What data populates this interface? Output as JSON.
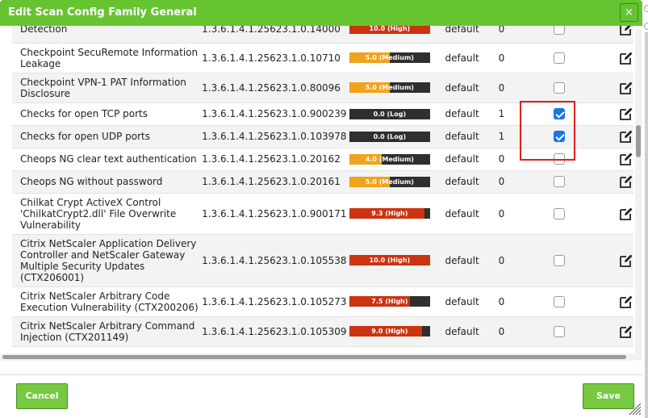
{
  "dialog": {
    "title": "Edit Scan Config Family General",
    "close_label": "×",
    "cancel_label": "Cancel",
    "save_label": "Save"
  },
  "colors": {
    "titlebar": "#66c430",
    "medium": "#f0a31c",
    "high": "#cc3311",
    "log": "#2f2f2f",
    "checkbox_checked": "#1a73e8",
    "highlight_box": "#e02020"
  },
  "rows": [
    {
      "name": "Detection",
      "oid": "1.3.6.1.4.1.25623.1.0.14000",
      "severity": {
        "label": "10.0 (High)",
        "level": "high",
        "fill_fraction": 1.0
      },
      "timeout": "default",
      "prefs": "0",
      "selected": false
    },
    {
      "name": "Checkpoint SecuRemote Information Leakage",
      "oid": "1.3.6.1.4.1.25623.1.0.10710",
      "severity": {
        "label": "5.0 (Medium)",
        "level": "medium",
        "fill_fraction": 0.5
      },
      "timeout": "default",
      "prefs": "0",
      "selected": false
    },
    {
      "name": "Checkpoint VPN-1 PAT Information Disclosure",
      "oid": "1.3.6.1.4.1.25623.1.0.80096",
      "severity": {
        "label": "5.0 (Medium)",
        "level": "medium",
        "fill_fraction": 0.5
      },
      "timeout": "default",
      "prefs": "0",
      "selected": false
    },
    {
      "name": "Checks for open TCP ports",
      "oid": "1.3.6.1.4.1.25623.1.0.900239",
      "severity": {
        "label": "0.0 (Log)",
        "level": "log",
        "fill_fraction": 0.0
      },
      "timeout": "default",
      "prefs": "1",
      "selected": true
    },
    {
      "name": "Checks for open UDP ports",
      "oid": "1.3.6.1.4.1.25623.1.0.103978",
      "severity": {
        "label": "0.0 (Log)",
        "level": "log",
        "fill_fraction": 0.0
      },
      "timeout": "default",
      "prefs": "1",
      "selected": true
    },
    {
      "name": "Cheops NG clear text authentication",
      "oid": "1.3.6.1.4.1.25623.1.0.20162",
      "severity": {
        "label": "4.0 (Medium)",
        "level": "medium",
        "fill_fraction": 0.4
      },
      "timeout": "default",
      "prefs": "0",
      "selected": false
    },
    {
      "name": "Cheops NG without password",
      "oid": "1.3.6.1.4.1.25623.1.0.20161",
      "severity": {
        "label": "5.0 (Medium)",
        "level": "medium",
        "fill_fraction": 0.5
      },
      "timeout": "default",
      "prefs": "0",
      "selected": false
    },
    {
      "name": "Chilkat Crypt ActiveX Control 'ChilkatCrypt2.dll' File Overwrite Vulnerability",
      "oid": "1.3.6.1.4.1.25623.1.0.900171",
      "severity": {
        "label": "9.3 (High)",
        "level": "high",
        "fill_fraction": 0.93
      },
      "timeout": "default",
      "prefs": "0",
      "selected": false
    },
    {
      "name": "Citrix NetScaler Application Delivery Controller and NetScaler Gateway Multiple Security Updates (CTX206001)",
      "oid": "1.3.6.1.4.1.25623.1.0.105538",
      "severity": {
        "label": "10.0 (High)",
        "level": "high",
        "fill_fraction": 1.0
      },
      "timeout": "default",
      "prefs": "0",
      "selected": false
    },
    {
      "name": "Citrix NetScaler Arbitrary Code Execution Vulnerability (CTX200206)",
      "oid": "1.3.6.1.4.1.25623.1.0.105273",
      "severity": {
        "label": "7.5 (High)",
        "level": "high",
        "fill_fraction": 0.75
      },
      "timeout": "default",
      "prefs": "0",
      "selected": false
    },
    {
      "name": "Citrix NetScaler Arbitrary Command Injection (CTX201149)",
      "oid": "1.3.6.1.4.1.25623.1.0.105309",
      "severity": {
        "label": "9.0 (High)",
        "level": "high",
        "fill_fraction": 0.9
      },
      "timeout": "default",
      "prefs": "0",
      "selected": false
    }
  ]
}
